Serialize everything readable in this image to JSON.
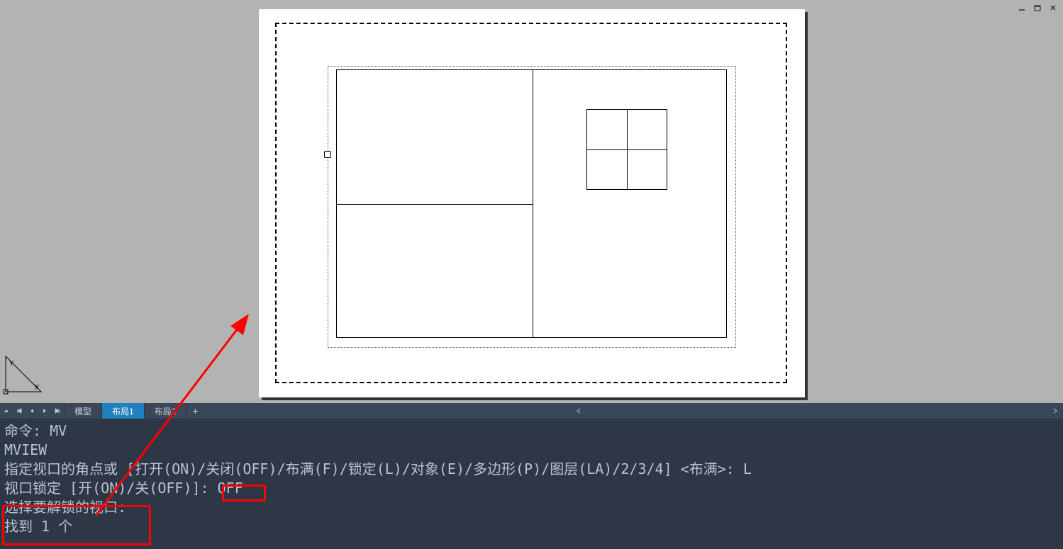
{
  "window_controls": {
    "min_title": "minimize",
    "max_title": "maximize",
    "close_title": "close"
  },
  "tabs": {
    "model": "模型",
    "layout1": "布局1",
    "layout2": "布局2",
    "add": "+"
  },
  "ucs": {
    "y": "Y",
    "x": "X"
  },
  "cmd": {
    "l1": "命令: MV",
    "l2": "MVIEW",
    "l3": "指定视口的角点或 [打开(ON)/关闭(OFF)/布满(F)/锁定(L)/对象(E)/多边形(P)/图层(LA)/2/3/4] <布满>: L",
    "l4": "视口锁定 [开(ON)/关(OFF)]: OFF",
    "l5": "选择要解锁的视口:",
    "l6": "找到 1 个"
  }
}
